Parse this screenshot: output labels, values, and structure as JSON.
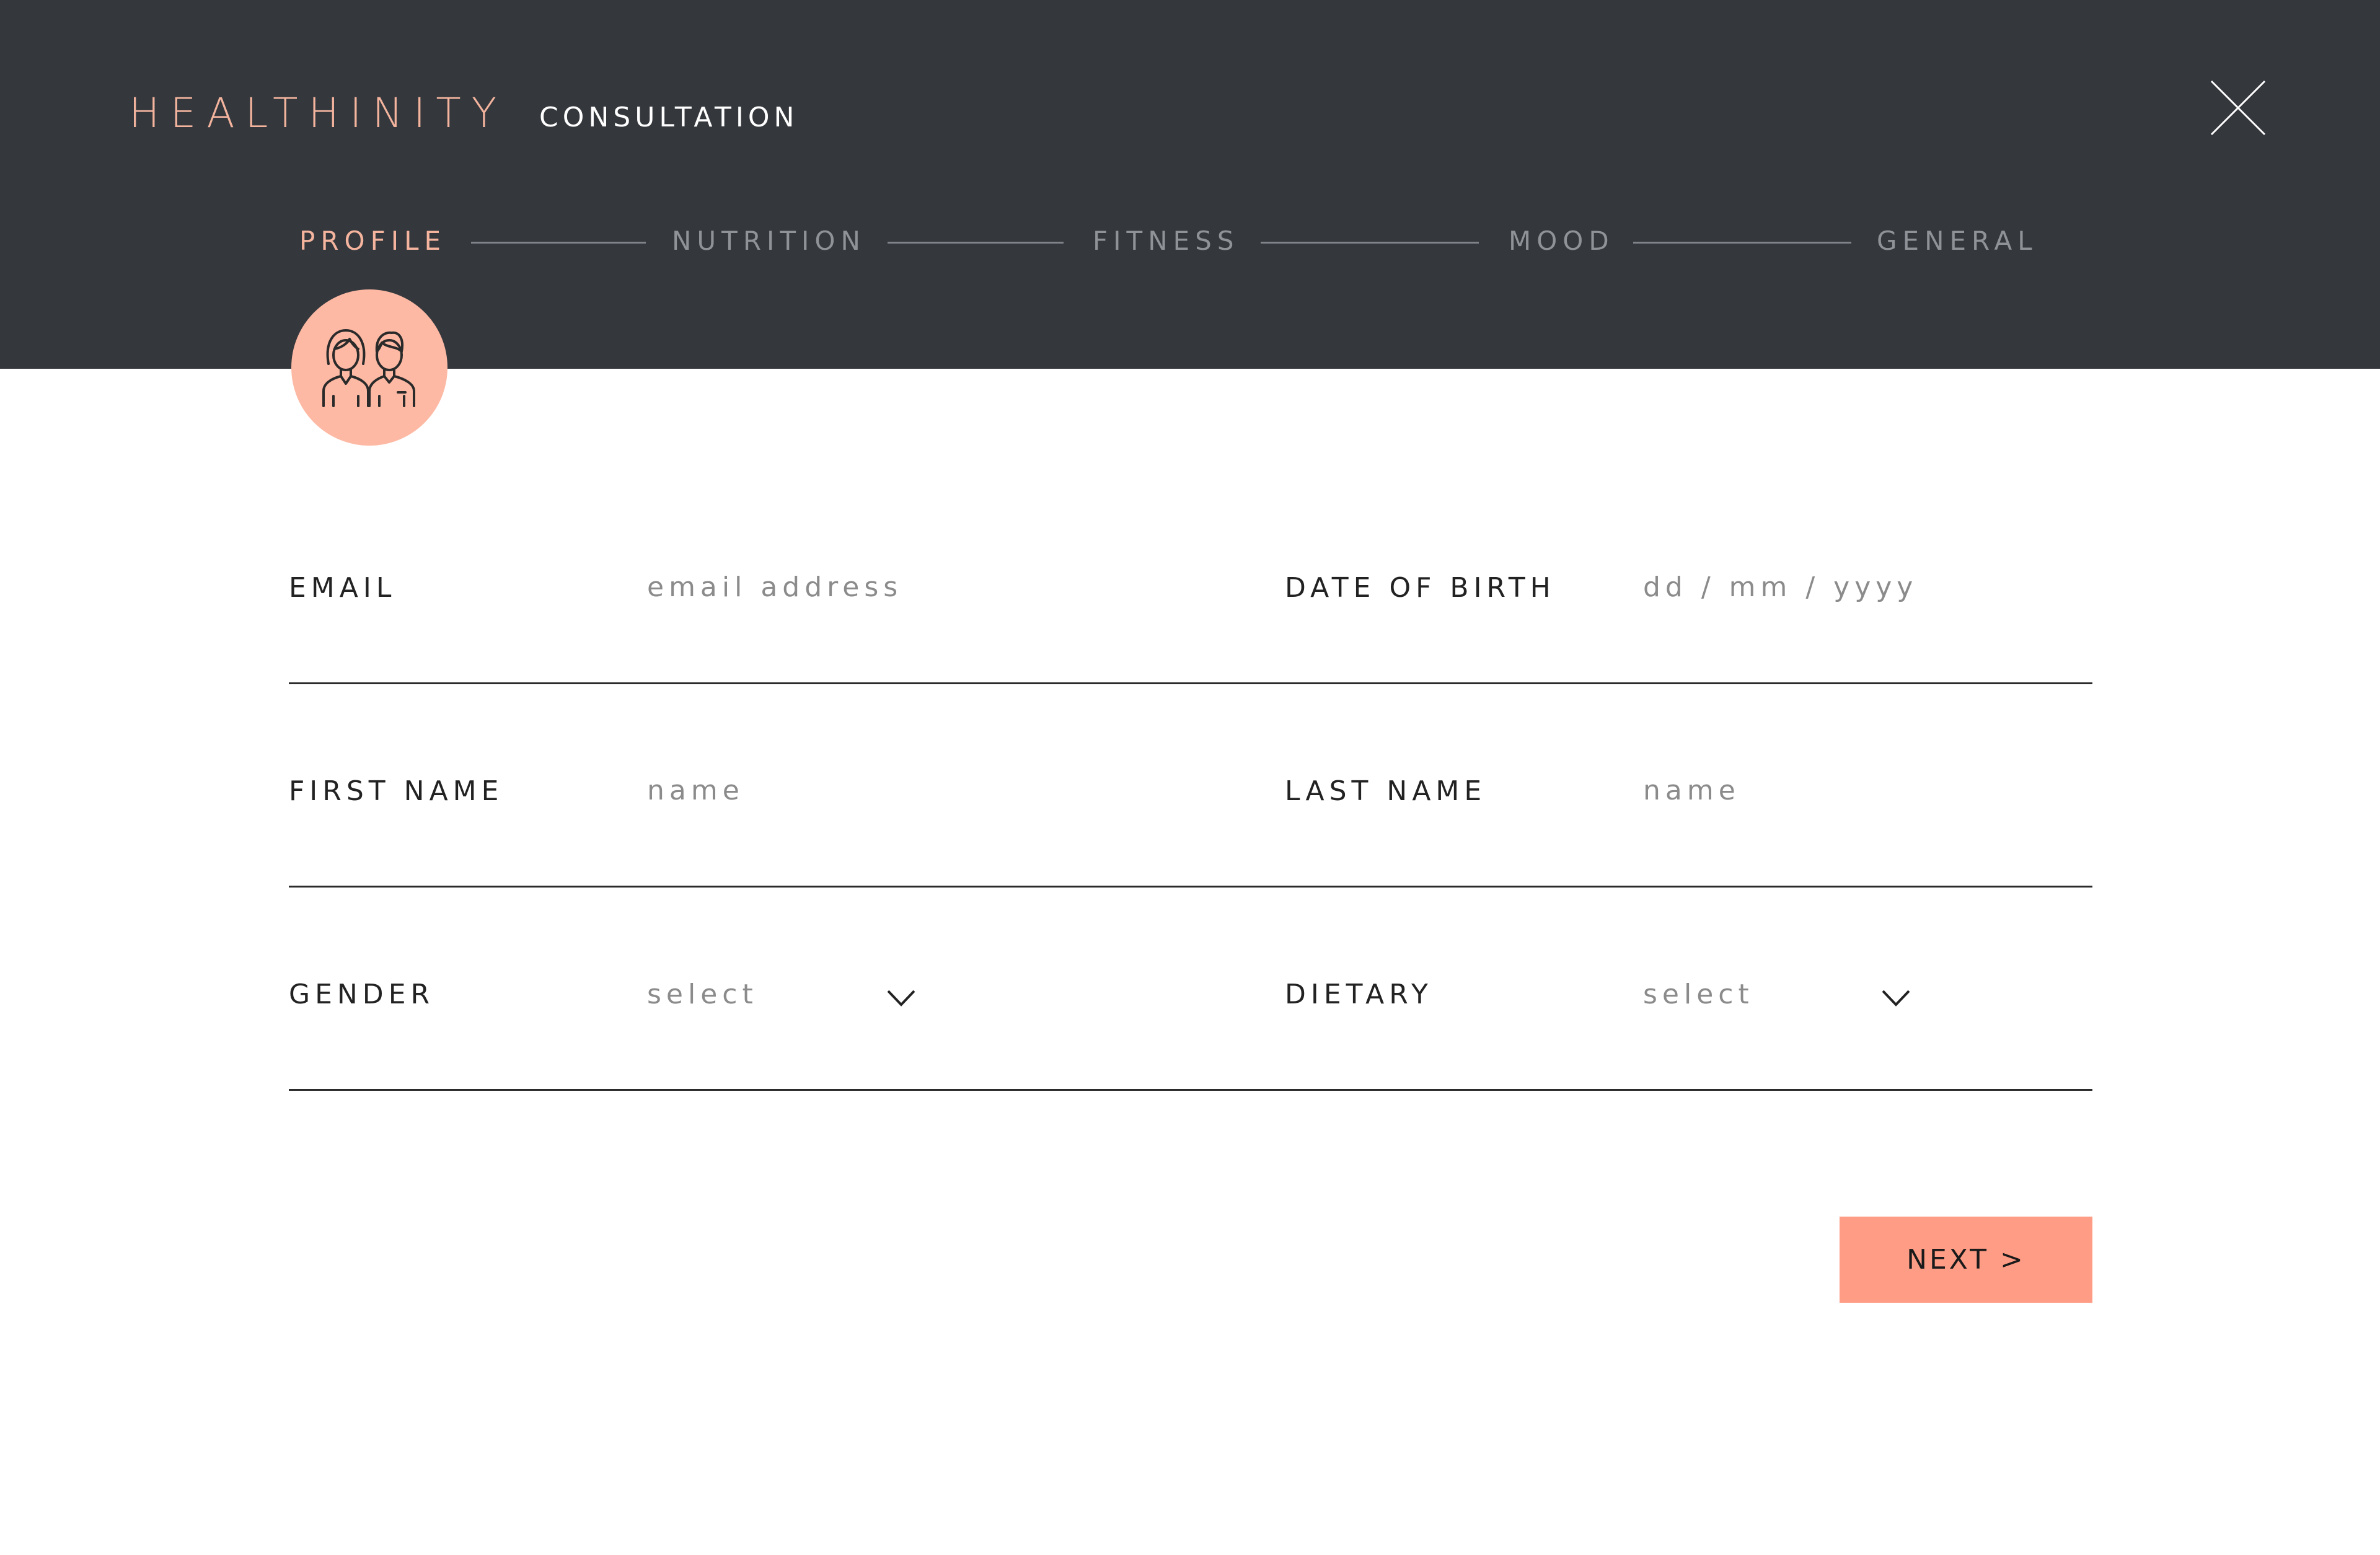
{
  "header": {
    "brand": "HEALTHINITY",
    "subtitle": "CONSULTATION",
    "close_icon": "close-icon"
  },
  "steps": [
    {
      "label": "PROFILE",
      "active": true
    },
    {
      "label": "NUTRITION",
      "active": false
    },
    {
      "label": "FITNESS",
      "active": false
    },
    {
      "label": "MOOD",
      "active": false
    },
    {
      "label": "GENERAL",
      "active": false
    }
  ],
  "avatar": {
    "icon": "users-couple-icon"
  },
  "form": {
    "email": {
      "label": "EMAIL",
      "placeholder": "email address",
      "value": ""
    },
    "dob": {
      "label": "DATE OF BIRTH",
      "placeholder": "dd / mm / yyyy",
      "value": ""
    },
    "first_name": {
      "label": "FIRST NAME",
      "placeholder": "name",
      "value": ""
    },
    "last_name": {
      "label": "LAST NAME",
      "placeholder": "name",
      "value": ""
    },
    "gender": {
      "label": "GENDER",
      "selected": "select"
    },
    "dietary": {
      "label": "DIETARY",
      "selected": "select"
    }
  },
  "actions": {
    "next_label": "NEXT >"
  },
  "colors": {
    "header_bg": "#34383d",
    "accent": "#f4b49e",
    "button_bg": "#ff9c85",
    "avatar_bg": "#fdb9a4",
    "inactive_step": "#8f9296"
  }
}
